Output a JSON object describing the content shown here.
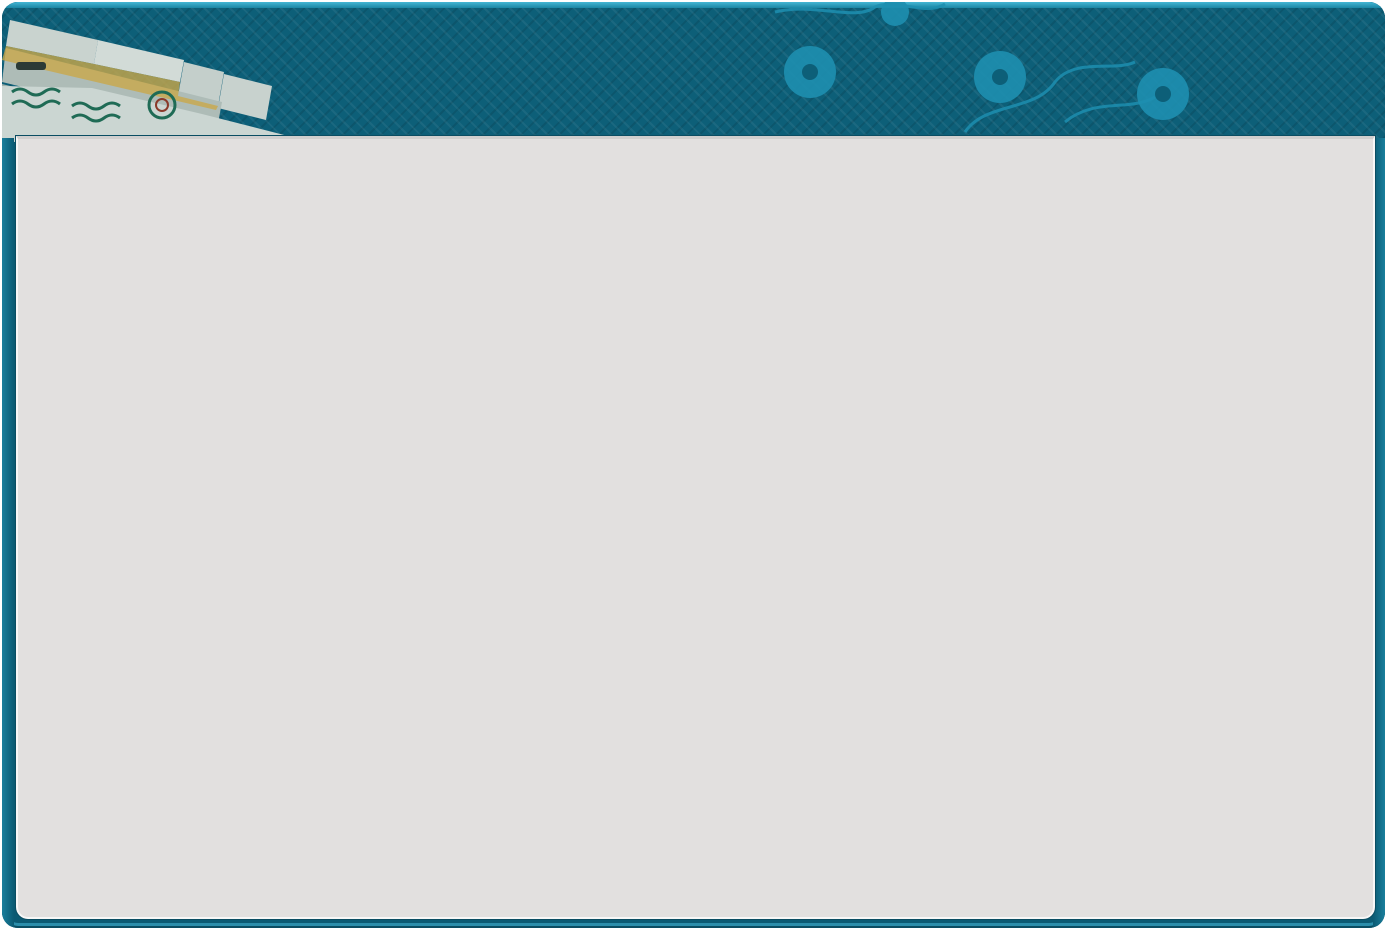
{
  "colors": {
    "frame": "#0b5a73",
    "frame_rim": "#2b8eab",
    "panel": "#e2e0df",
    "floral": "#1e8fb0",
    "tile_face": "#dfe6e2",
    "tile_mark": "#1f6b55"
  },
  "header": {
    "decoration_left": "mahjong-tiles",
    "decoration_right": "floral-pattern"
  },
  "panel": {
    "state": "empty"
  }
}
